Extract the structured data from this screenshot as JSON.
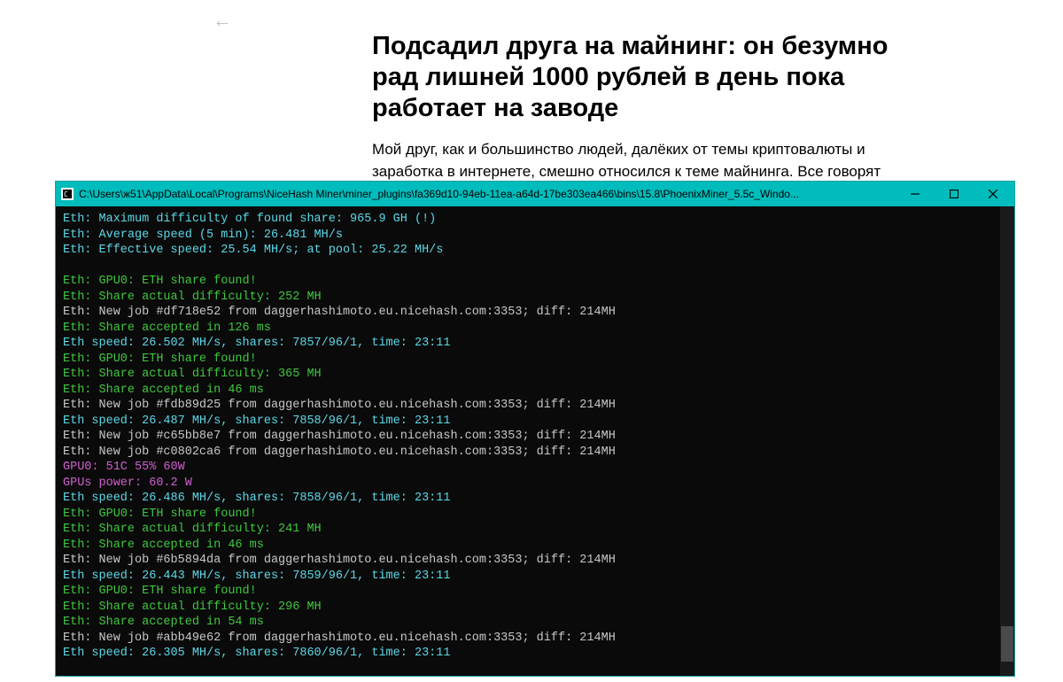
{
  "back_arrow": "←",
  "article": {
    "title": "Подсадил друга на майнинг: он безумно рад лишней 1000 рублей в день пока работает на заводе",
    "lead": "Мой друг, как и большинство людей, далёких от темы криптовалюты и заработка в интернете, смешно относился к теме майнинга. Все говорят"
  },
  "window": {
    "title": "C:\\Users\\ж51\\AppData\\Local\\Programs\\NiceHash Miner\\miner_plugins\\fa369d10-94eb-11ea-a64d-17be303ea466\\bins\\15.8\\PhoenixMiner_5.5c_Windo...",
    "controls": {
      "min": "minimize",
      "max": "maximize",
      "close": "close"
    }
  },
  "log": [
    {
      "cls": "cyan",
      "t": "Eth: Maximum difficulty of found share: 965.9 GH (!)"
    },
    {
      "cls": "cyan",
      "t": "Eth: Average speed (5 min): 26.481 MH/s"
    },
    {
      "cls": "cyan",
      "t": "Eth: Effective speed: 25.54 MH/s; at pool: 25.22 MH/s"
    },
    {
      "cls": "blank",
      "t": ""
    },
    {
      "cls": "green",
      "t": "Eth: GPU0: ETH share found!"
    },
    {
      "cls": "green",
      "t": "Eth: Share actual difficulty: 252 MH"
    },
    {
      "cls": "white",
      "t": "Eth: New job #df718e52 from daggerhashimoto.eu.nicehash.com:3353; diff: 214MH"
    },
    {
      "cls": "green",
      "t": "Eth: Share accepted in 126 ms"
    },
    {
      "cls": "cyan",
      "t": "Eth speed: 26.502 MH/s, shares: 7857/96/1, time: 23:11"
    },
    {
      "cls": "green",
      "t": "Eth: GPU0: ETH share found!"
    },
    {
      "cls": "green",
      "t": "Eth: Share actual difficulty: 365 MH"
    },
    {
      "cls": "green",
      "t": "Eth: Share accepted in 46 ms"
    },
    {
      "cls": "white",
      "t": "Eth: New job #fdb89d25 from daggerhashimoto.eu.nicehash.com:3353; diff: 214MH"
    },
    {
      "cls": "cyan",
      "t": "Eth speed: 26.487 MH/s, shares: 7858/96/1, time: 23:11"
    },
    {
      "cls": "white",
      "t": "Eth: New job #c65bb8e7 from daggerhashimoto.eu.nicehash.com:3353; diff: 214MH"
    },
    {
      "cls": "white",
      "t": "Eth: New job #c0802ca6 from daggerhashimoto.eu.nicehash.com:3353; diff: 214MH"
    },
    {
      "cls": "magenta",
      "t": "GPU0: 51C 55% 60W"
    },
    {
      "cls": "magenta",
      "t": "GPUs power: 60.2 W"
    },
    {
      "cls": "cyan",
      "t": "Eth speed: 26.486 MH/s, shares: 7858/96/1, time: 23:11"
    },
    {
      "cls": "green",
      "t": "Eth: GPU0: ETH share found!"
    },
    {
      "cls": "green",
      "t": "Eth: Share actual difficulty: 241 MH"
    },
    {
      "cls": "green",
      "t": "Eth: Share accepted in 46 ms"
    },
    {
      "cls": "white",
      "t": "Eth: New job #6b5894da from daggerhashimoto.eu.nicehash.com:3353; diff: 214MH"
    },
    {
      "cls": "cyan",
      "t": "Eth speed: 26.443 MH/s, shares: 7859/96/1, time: 23:11"
    },
    {
      "cls": "green",
      "t": "Eth: GPU0: ETH share found!"
    },
    {
      "cls": "green",
      "t": "Eth: Share actual difficulty: 296 MH"
    },
    {
      "cls": "green",
      "t": "Eth: Share accepted in 54 ms"
    },
    {
      "cls": "white",
      "t": "Eth: New job #abb49e62 from daggerhashimoto.eu.nicehash.com:3353; diff: 214MH"
    },
    {
      "cls": "cyan",
      "t": "Eth speed: 26.305 MH/s, shares: 7860/96/1, time: 23:11"
    }
  ]
}
